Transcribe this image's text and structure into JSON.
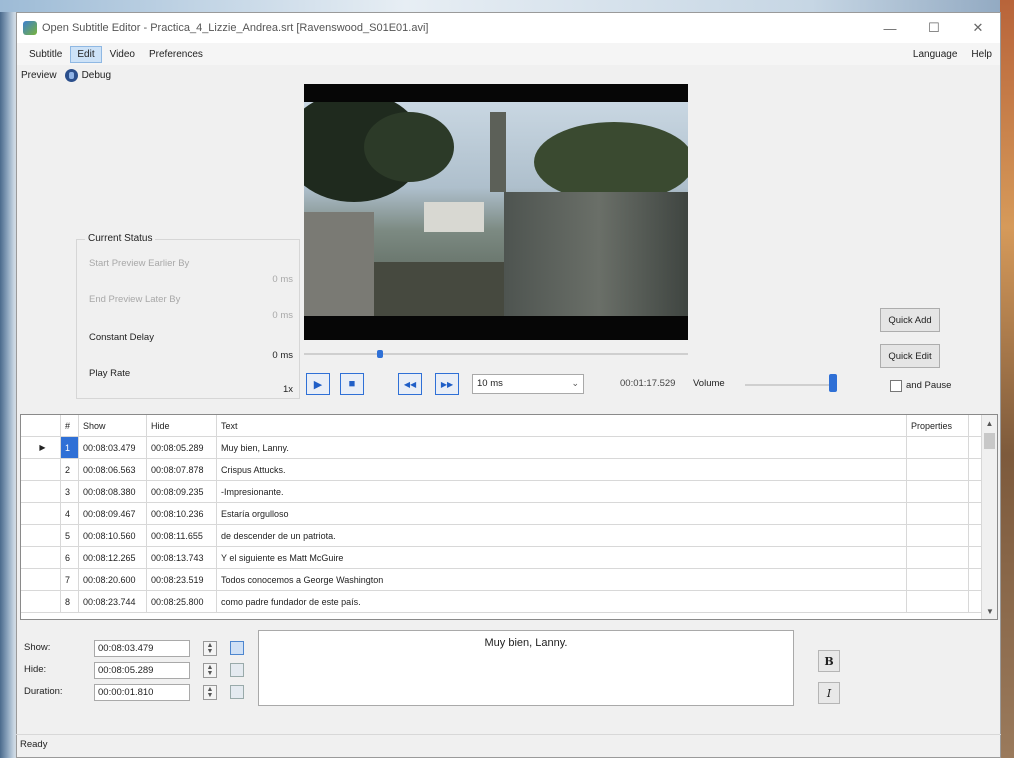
{
  "window": {
    "title": "Open Subtitle Editor - Practica_4_Lizzie_Andrea.srt [Ravenswood_S01E01.avi]",
    "controls": {
      "minimize": "—",
      "maximize": "☐",
      "close": "✕"
    }
  },
  "menu": {
    "left": [
      "Subtitle",
      "Edit",
      "Video",
      "Preferences"
    ],
    "active": "Edit",
    "right": [
      "Language",
      "Help"
    ]
  },
  "toolbar": {
    "preview": "Preview",
    "debug": "Debug"
  },
  "status_panel": {
    "legend": "Current Status",
    "start_preview": {
      "label": "Start Preview Earlier By",
      "value": "0 ms"
    },
    "end_preview": {
      "label": "End Preview Later By",
      "value": "0 ms"
    },
    "constant_delay": {
      "label": "Constant Delay",
      "value": "0 ms"
    },
    "play_rate": {
      "label": "Play Rate",
      "value": "1x"
    }
  },
  "player": {
    "seek_position": 0.19,
    "step_select": "10 ms",
    "time": "00:01:17.529",
    "volume_label": "Volume",
    "volume_level": 0.98,
    "buttons": {
      "play": "▶",
      "stop": "■",
      "back": "◀◀",
      "forward": "▶▶"
    }
  },
  "side_buttons": {
    "quick_add": "Quick Add",
    "quick_edit": "Quick Edit",
    "and_pause": "and Pause"
  },
  "grid": {
    "headers": {
      "num": "#",
      "show": "Show",
      "hide": "Hide",
      "text": "Text",
      "properties": "Properties"
    },
    "rows": [
      {
        "num": "1",
        "show": "00:08:03.479",
        "hide": "00:08:05.289",
        "text": "Muy bien, Lanny."
      },
      {
        "num": "2",
        "show": "00:08:06.563",
        "hide": "00:08:07.878",
        "text": "Crispus Attucks."
      },
      {
        "num": "3",
        "show": "00:08:08.380",
        "hide": "00:08:09.235",
        "text": "-Impresionante."
      },
      {
        "num": "4",
        "show": "00:08:09.467",
        "hide": "00:08:10.236",
        "text": "Estaría orgulloso"
      },
      {
        "num": "5",
        "show": "00:08:10.560",
        "hide": "00:08:11.655",
        "text": "de descender de un patriota."
      },
      {
        "num": "6",
        "show": "00:08:12.265",
        "hide": "00:08:13.743",
        "text": "Y el siguiente es Matt McGuire"
      },
      {
        "num": "7",
        "show": "00:08:20.600",
        "hide": "00:08:23.519",
        "text": "Todos conocemos a George Washington"
      },
      {
        "num": "8",
        "show": "00:08:23.744",
        "hide": "00:08:25.800",
        "text": "como padre fundador de este país."
      }
    ],
    "selected_index": 0
  },
  "editor": {
    "show_label": "Show:",
    "hide_label": "Hide:",
    "duration_label": "Duration:",
    "show_value": "00:08:03.479",
    "hide_value": "00:08:05.289",
    "duration_value": "00:00:01.810",
    "text": "Muy bien, Lanny.",
    "bold": "B",
    "italic": "I"
  },
  "statusbar": {
    "text": "Ready"
  }
}
